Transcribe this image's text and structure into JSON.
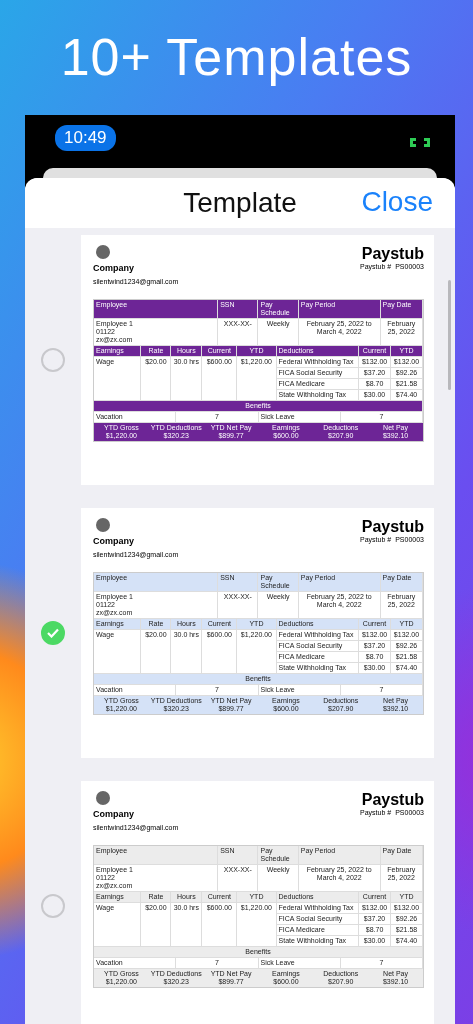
{
  "heading": "10+ Templates",
  "status_bar": {
    "time": "10:49"
  },
  "sheet": {
    "title": "Template",
    "close": "Close"
  },
  "templates": [
    {
      "selected": false,
      "kind": "purple",
      "paystub": {
        "title": "Paystub",
        "number_label": "Paystub #",
        "number": "PS00003",
        "company": "Company",
        "email": "silentwind1234@gmail.com",
        "info": [
          {
            "label": "Employee",
            "lines": [
              "Employee 1",
              "01122",
              "zx@zx.com"
            ]
          },
          {
            "label": "SSN",
            "lines": [
              "XXX-XX-"
            ]
          },
          {
            "label": "Pay Schedule",
            "lines": [
              "Weekly"
            ]
          },
          {
            "label": "Pay Period",
            "lines": [
              "February 25, 2022 to March 4, 2022"
            ]
          },
          {
            "label": "Pay Date",
            "lines": [
              "February 25, 2022"
            ]
          }
        ],
        "earnings": {
          "columns": [
            "Earnings",
            "Rate",
            "Hours",
            "Current",
            "YTD"
          ],
          "rows": [
            [
              "Wage",
              "$20.00",
              "30.0 hrs",
              "$600.00",
              "$1,220.00"
            ]
          ]
        },
        "deductions": {
          "columns": [
            "Deductions",
            "Current",
            "YTD"
          ],
          "rows": [
            [
              "Federal Withholding Tax",
              "$132.00",
              "$132.00"
            ],
            [
              "FICA Social Security",
              "$37.20",
              "$92.26"
            ],
            [
              "FICA Medicare",
              "$8.70",
              "$21.58"
            ],
            [
              "State Withholding Tax",
              "$30.00",
              "$74.40"
            ]
          ]
        },
        "benefits": {
          "title": "Benefits",
          "items": [
            {
              "name": "Vacation",
              "value": "7"
            },
            {
              "name": "Sick Leave",
              "value": "7"
            }
          ]
        },
        "summary": [
          {
            "label": "YTD Gross",
            "value": "$1,220.00"
          },
          {
            "label": "YTD Deductions",
            "value": "$320.23"
          },
          {
            "label": "YTD Net Pay",
            "value": "$899.77"
          },
          {
            "label": "Earnings",
            "value": "$600.00"
          },
          {
            "label": "Deductions",
            "value": "$207.90"
          },
          {
            "label": "Net Pay",
            "value": "$392.10"
          }
        ]
      }
    },
    {
      "selected": true,
      "kind": "blue",
      "paystub": {
        "title": "Paystub",
        "number_label": "Paystub #",
        "number": "PS00003",
        "company": "Company",
        "email": "silentwind1234@gmail.com",
        "info": [
          {
            "label": "Employee",
            "lines": [
              "Employee 1",
              "01122",
              "zx@zx.com"
            ]
          },
          {
            "label": "SSN",
            "lines": [
              "XXX-XX-"
            ]
          },
          {
            "label": "Pay Schedule",
            "lines": [
              "Weekly"
            ]
          },
          {
            "label": "Pay Period",
            "lines": [
              "February 25, 2022 to March 4, 2022"
            ]
          },
          {
            "label": "Pay Date",
            "lines": [
              "February 25, 2022"
            ]
          }
        ],
        "earnings": {
          "columns": [
            "Earnings",
            "Rate",
            "Hours",
            "Current",
            "YTD"
          ],
          "rows": [
            [
              "Wage",
              "$20.00",
              "30.0 hrs",
              "$600.00",
              "$1,220.00"
            ]
          ]
        },
        "deductions": {
          "columns": [
            "Deductions",
            "Current",
            "YTD"
          ],
          "rows": [
            [
              "Federal Withholding Tax",
              "$132.00",
              "$132.00"
            ],
            [
              "FICA Social Security",
              "$37.20",
              "$92.26"
            ],
            [
              "FICA Medicare",
              "$8.70",
              "$21.58"
            ],
            [
              "State Withholding Tax",
              "$30.00",
              "$74.40"
            ]
          ]
        },
        "benefits": {
          "title": "Benefits",
          "items": [
            {
              "name": "Vacation",
              "value": "7"
            },
            {
              "name": "Sick Leave",
              "value": "7"
            }
          ]
        },
        "summary": [
          {
            "label": "YTD Gross",
            "value": "$1,220.00"
          },
          {
            "label": "YTD Deductions",
            "value": "$320.23"
          },
          {
            "label": "YTD Net Pay",
            "value": "$899.77"
          },
          {
            "label": "Earnings",
            "value": "$600.00"
          },
          {
            "label": "Deductions",
            "value": "$207.90"
          },
          {
            "label": "Net Pay",
            "value": "$392.10"
          }
        ]
      }
    },
    {
      "selected": false,
      "kind": "gray",
      "paystub": {
        "title": "Paystub",
        "number_label": "Paystub #",
        "number": "PS00003",
        "company": "Company",
        "email": "silentwind1234@gmail.com",
        "info": [
          {
            "label": "Employee",
            "lines": [
              "Employee 1",
              "01122",
              "zx@zx.com"
            ]
          },
          {
            "label": "SSN",
            "lines": [
              "XXX-XX-"
            ]
          },
          {
            "label": "Pay Schedule",
            "lines": [
              "Weekly"
            ]
          },
          {
            "label": "Pay Period",
            "lines": [
              "February 25, 2022 to March 4, 2022"
            ]
          },
          {
            "label": "Pay Date",
            "lines": [
              "February 25, 2022"
            ]
          }
        ],
        "earnings": {
          "columns": [
            "Earnings",
            "Rate",
            "Hours",
            "Current",
            "YTD"
          ],
          "rows": [
            [
              "Wage",
              "$20.00",
              "30.0 hrs",
              "$600.00",
              "$1,220.00"
            ]
          ]
        },
        "deductions": {
          "columns": [
            "Deductions",
            "Current",
            "YTD"
          ],
          "rows": [
            [
              "Federal Withholding Tax",
              "$132.00",
              "$132.00"
            ],
            [
              "FICA Social Security",
              "$37.20",
              "$92.26"
            ],
            [
              "FICA Medicare",
              "$8.70",
              "$21.58"
            ],
            [
              "State Withholding Tax",
              "$30.00",
              "$74.40"
            ]
          ]
        },
        "benefits": {
          "title": "Benefits",
          "items": [
            {
              "name": "Vacation",
              "value": "7"
            },
            {
              "name": "Sick Leave",
              "value": "7"
            }
          ]
        },
        "summary": [
          {
            "label": "YTD Gross",
            "value": "$1,220.00"
          },
          {
            "label": "YTD Deductions",
            "value": "$320.23"
          },
          {
            "label": "YTD Net Pay",
            "value": "$899.77"
          },
          {
            "label": "Earnings",
            "value": "$600.00"
          },
          {
            "label": "Deductions",
            "value": "$207.90"
          },
          {
            "label": "Net Pay",
            "value": "$392.10"
          }
        ]
      }
    }
  ]
}
